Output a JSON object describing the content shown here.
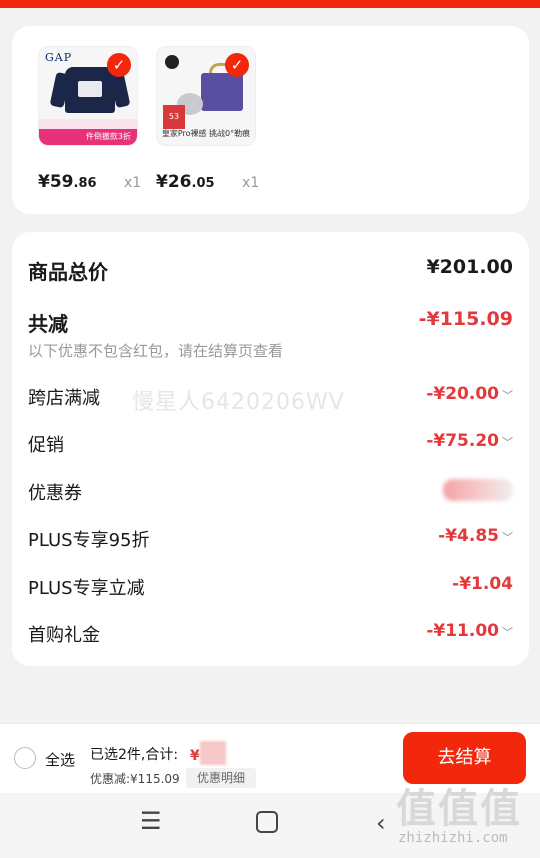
{
  "products": [
    {
      "brand": "GAP",
      "banner": "件倒撤款3折",
      "price": "¥59",
      "price_dec": ".86",
      "qty": "x1"
    },
    {
      "tag": "53",
      "caption": "皇家Pro裸感 挑战0°勒痕",
      "price": "¥26",
      "price_dec": ".05",
      "qty": "x1"
    }
  ],
  "summary": {
    "total_label": "商品总价",
    "total_value": "¥201.00",
    "reduce_label": "共减",
    "reduce_value": "-¥115.09",
    "note": "以下优惠不包含红包，请在结算页查看",
    "watermark": "慢星人6420206WV",
    "items": [
      {
        "label": "跨店满减",
        "value": "-¥20.00",
        "chevron": true
      },
      {
        "label": "促销",
        "value": "-¥75.20",
        "chevron": true
      },
      {
        "label": "优惠券",
        "value": "",
        "chevron": true
      },
      {
        "label": "PLUS专享95折",
        "value": "-¥4.85",
        "chevron": true
      },
      {
        "label": "PLUS专享立减",
        "value": "-¥1.04",
        "chevron": false
      },
      {
        "label": "首购礼金",
        "value": "-¥11.00",
        "chevron": true
      }
    ]
  },
  "bottom": {
    "select_all": "全选",
    "selected": "已选2件,合计:",
    "total_partial": "¥",
    "discount": "优惠减:¥115.09",
    "detail": "优惠明细",
    "checkout": "去结算"
  },
  "watermark_site": {
    "logo": "值值值",
    "url": "zhizhizhi.com"
  },
  "colors": {
    "accent": "#f2270c",
    "discount_red": "#e4393c"
  }
}
